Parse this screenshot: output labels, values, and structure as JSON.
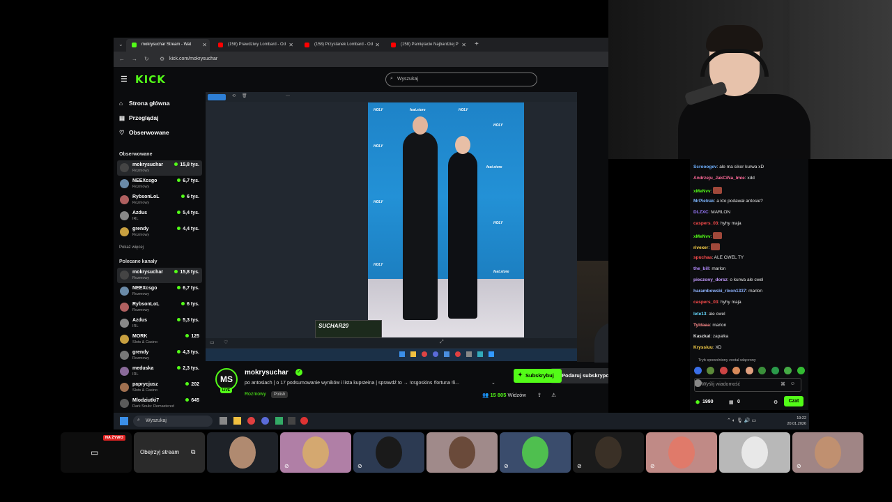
{
  "browser": {
    "tabs": [
      {
        "title": "mokrysuchar Stream - Wat",
        "favicon_color": "#53fc18",
        "active": true
      },
      {
        "title": "(158) Prawdziwy Lombard - Od",
        "favicon_color": "#ff0000",
        "active": false
      },
      {
        "title": "(158) Przystanek Lombard - Od",
        "favicon_color": "#ff0000",
        "active": false
      },
      {
        "title": "(158) Pamiętacie Najbardziej P",
        "favicon_color": "#ff0000",
        "active": false
      }
    ],
    "url": "kick.com/mokrysuchar"
  },
  "kick": {
    "logo": "KICK",
    "search_placeholder": "Wyszukaj",
    "nav": [
      {
        "label": "Strona główna",
        "icon": "home-icon"
      },
      {
        "label": "Przeglądaj",
        "icon": "browse-icon"
      },
      {
        "label": "Obserwowane",
        "icon": "heart-icon"
      }
    ],
    "followed_title": "Obserwowane",
    "followed": [
      {
        "name": "mokrysuchar",
        "category": "Rozmowy",
        "viewers": "15,8 tys."
      },
      {
        "name": "NEEXcsgo",
        "category": "Rozmowy",
        "viewers": "6,7 tys."
      },
      {
        "name": "RybsonLoL",
        "category": "Rozmowy",
        "viewers": "6 tys."
      },
      {
        "name": "Azdus",
        "category": "IRL",
        "viewers": "5,4 tys."
      },
      {
        "name": "grendy",
        "category": "Rozmowy",
        "viewers": "4,4 tys."
      }
    ],
    "show_more": "Pokaż więcej",
    "recommended_title": "Polecane kanały",
    "recommended": [
      {
        "name": "mokrysuchar",
        "category": "Rozmowy",
        "viewers": "15,8 tys."
      },
      {
        "name": "NEEXcsgo",
        "category": "Rozmowy",
        "viewers": "6,7 tys."
      },
      {
        "name": "RybsonLoL",
        "category": "Rozmowy",
        "viewers": "6 tys."
      },
      {
        "name": "Azdus",
        "category": "IRL",
        "viewers": "5,3 tys."
      },
      {
        "name": "MORK",
        "category": "Slots & Casino",
        "viewers": "125"
      },
      {
        "name": "grendy",
        "category": "Rozmowy",
        "viewers": "4,3 tys."
      },
      {
        "name": "meduska",
        "category": "IRL",
        "viewers": "2,3 tys."
      },
      {
        "name": "paprycjusz",
        "category": "Slots & Casino",
        "viewers": "202"
      },
      {
        "name": "Mlodziutki7",
        "category": "Dark Souls: Remastered",
        "viewers": "645"
      }
    ],
    "photo_ad": "SUCHAR20",
    "channel": {
      "avatar_text": "MS",
      "live_label": "LIVE",
      "name": "mokrysuchar",
      "title": "po antosiach | o 17 podsumowanie wyników i lista kupsteina | sprawdź to → !csgoskins !fortuna !li...",
      "category": "Rozmowy",
      "language": "Polish",
      "gift_sub": "Podaruj subskrypcje",
      "subscribe": "Subskrybuj",
      "viewers_count": "15 805",
      "viewers_label": "Widzów"
    }
  },
  "chat": {
    "messages": [
      {
        "user": "Scrooogev",
        "color": "#6fb1ff",
        "text": "ale ma sikor kurwa xD",
        "emote": false
      },
      {
        "user": "Andrzeju_JakCiNa_Imie",
        "color": "#ff6b9a",
        "text": "xdd",
        "emote": false
      },
      {
        "user": "xMeNvv",
        "color": "#53fc18",
        "text": "",
        "emote": true
      },
      {
        "user": "MrPietrak",
        "color": "#7fb7ff",
        "text": "a kto podawał antosie?",
        "emote": false
      },
      {
        "user": "DLZXC",
        "color": "#9b7bff",
        "text": "MARLON",
        "emote": false
      },
      {
        "user": "caspers_03",
        "color": "#ff4d4d",
        "text": "hyhy maja",
        "emote": false
      },
      {
        "user": "xMeNvv",
        "color": "#53fc18",
        "text": "",
        "emote": true
      },
      {
        "user": "rivexer",
        "color": "#ffd54a",
        "text": "",
        "emote": true
      },
      {
        "user": "spuchaa",
        "color": "#ff4d4d",
        "text": "ALE CWEL TY",
        "emote": false
      },
      {
        "user": "the_bill",
        "color": "#b58cff",
        "text": "marlon",
        "emote": false
      },
      {
        "user": "pieczony_dorsz",
        "color": "#c49bff",
        "text": "o kurwa ale cwel",
        "emote": false
      },
      {
        "user": "harambowski_rixon1337",
        "color": "#8fb4ff",
        "text": "marlon",
        "emote": false
      },
      {
        "user": "caspers_03",
        "color": "#ff4d4d",
        "text": "hyhy maja",
        "emote": false
      },
      {
        "user": "lete13",
        "color": "#66d9ff",
        "text": "ale cwel",
        "emote": false
      },
      {
        "user": "Tyldaaa",
        "color": "#ff8c8c",
        "text": "marlon",
        "emote": false
      },
      {
        "user": "Kaszkal",
        "color": "#e0e0e0",
        "text": "zapałka",
        "emote": false
      },
      {
        "user": "Kryssiuu",
        "color": "#ffd54a",
        "text": "XD",
        "emote": false
      }
    ],
    "slow_mode": "Tryb spowolniony został włączony",
    "input_placeholder": "Wyślij wiadomość",
    "points": "1990",
    "stash": "0",
    "send_label": "Czat"
  },
  "taskbar": {
    "search_placeholder": "Wyszukaj",
    "time": "19:22",
    "date": "20.01.2026"
  },
  "call": {
    "live_badge": "NA ŻYWO",
    "watch_stream": "Obejrzyj stream",
    "tile_colors": [
      "#3a4250",
      "#b07fa6",
      "#2c3a52",
      "#a08a8a",
      "#3a4c6c",
      "#1b1b1b",
      "#c08a86",
      "#b8b8b8",
      "#a08585"
    ]
  }
}
